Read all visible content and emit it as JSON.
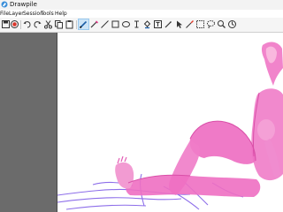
{
  "window": {
    "title": "Drawpile",
    "app_icon": "drawpile-logo-icon"
  },
  "menu": {
    "items": [
      {
        "label": "File"
      },
      {
        "label": "Layer"
      },
      {
        "label": "Session"
      },
      {
        "label": "Tools"
      },
      {
        "label": "Help"
      }
    ]
  },
  "toolbar": {
    "left_tools": [
      "save-icon",
      "record-icon",
      "undo-icon",
      "redo-icon",
      "cut-icon",
      "copy-icon",
      "paste-icon"
    ],
    "drawing_tools": [
      "brush-icon",
      "eraser-icon",
      "line-icon",
      "rectangle-icon",
      "ellipse-icon",
      "text-cursor-icon",
      "fill-bucket-icon",
      "text-annotation-icon",
      "color-picker-icon",
      "pointer-icon",
      "laser-icon",
      "selection-icon",
      "lasso-icon",
      "zoom-icon",
      "inspector-icon"
    ],
    "active_tool": "brush-icon"
  },
  "colors": {
    "accent_active": "#cce4f7",
    "panel_dark": "#6b6b6b",
    "sketch_pink": "#ee6fc2",
    "sketch_purple": "#7a55e6"
  }
}
